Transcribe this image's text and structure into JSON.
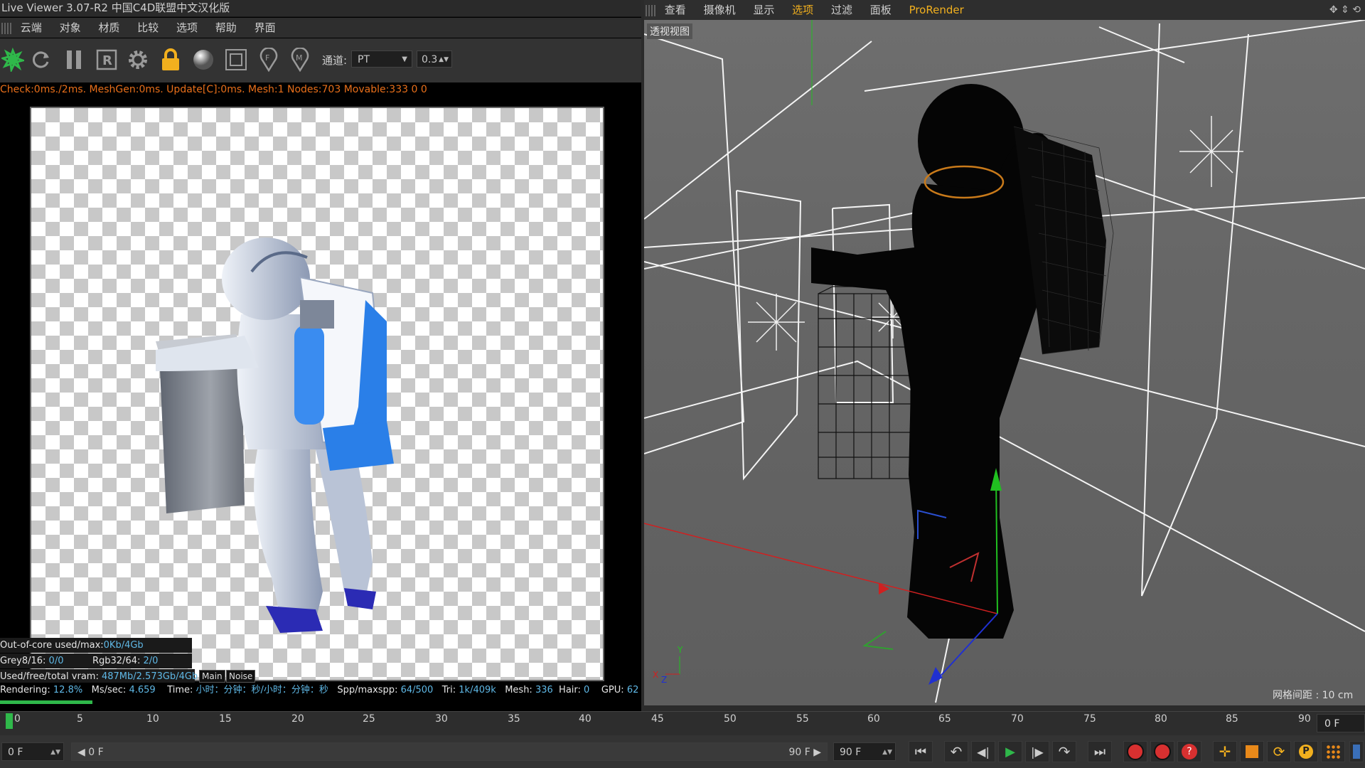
{
  "live_viewer": {
    "title": "Live Viewer 3.07-R2 中国C4D联盟中文汉化版",
    "menu": [
      "云端",
      "对象",
      "材质",
      "比较",
      "选项",
      "帮助",
      "界面"
    ],
    "channel_label": "通道:",
    "channel_value": "PT",
    "value_field": "0.3",
    "status_line": "Check:0ms./2ms. MeshGen:0ms. Update[C]:0ms. Mesh:1 Nodes:703 Movable:333  0 0",
    "stats": {
      "out_of_core_label": "Out-of-core used/max:",
      "out_of_core_value": "0Kb/4Gb",
      "grey_label": "Grey8/16:",
      "grey_value": "0/0",
      "rgb_label": "Rgb32/64:",
      "rgb_value": "2/0",
      "vram_label": "Used/free/total vram:",
      "vram_value": "487Mb/2.573Gb/4Gb"
    },
    "tabs": [
      "Main",
      "Noise"
    ],
    "bottom": {
      "rendering_label": "Rendering:",
      "rendering_value": "12.8%",
      "ms_label": "Ms/sec:",
      "ms_value": "4.659",
      "time_label": "Time:",
      "time_value": "小时：分钟：秒/小时：分钟：秒",
      "spp_label": "Spp/maxspp:",
      "spp_value": "64/500",
      "tri_label": "Tri:",
      "tri_value": "1k/409k",
      "mesh_label": "Mesh:",
      "mesh_value": "336",
      "hair_label": "Hair:",
      "hair_value": "0",
      "gpu_label": "GPU:",
      "gpu_value": "62"
    },
    "progress": 0.128
  },
  "viewport": {
    "menu": [
      "查看",
      "摄像机",
      "显示",
      "选项",
      "过滤",
      "面板",
      "ProRender"
    ],
    "active_menu": "选项",
    "label": "透视视图",
    "grid_spacing": "网格间距 : 10 cm"
  },
  "timeline": {
    "ticks": [
      "0",
      "5",
      "10",
      "15",
      "20",
      "25",
      "30",
      "35",
      "40",
      "45",
      "50",
      "55",
      "60",
      "65",
      "70",
      "75",
      "80",
      "85",
      "90"
    ],
    "end_frame": "0 F"
  },
  "controls": {
    "current_frame": "0 F",
    "range_start": "◀ 0 F",
    "range_end": "90 F ▶",
    "max_frame": "90 F"
  },
  "colors": {
    "accent_green": "#2fb84a",
    "status_orange": "#e86f1a",
    "stat_blue": "#5fb8e6",
    "lock_yellow": "#f2b01e"
  }
}
